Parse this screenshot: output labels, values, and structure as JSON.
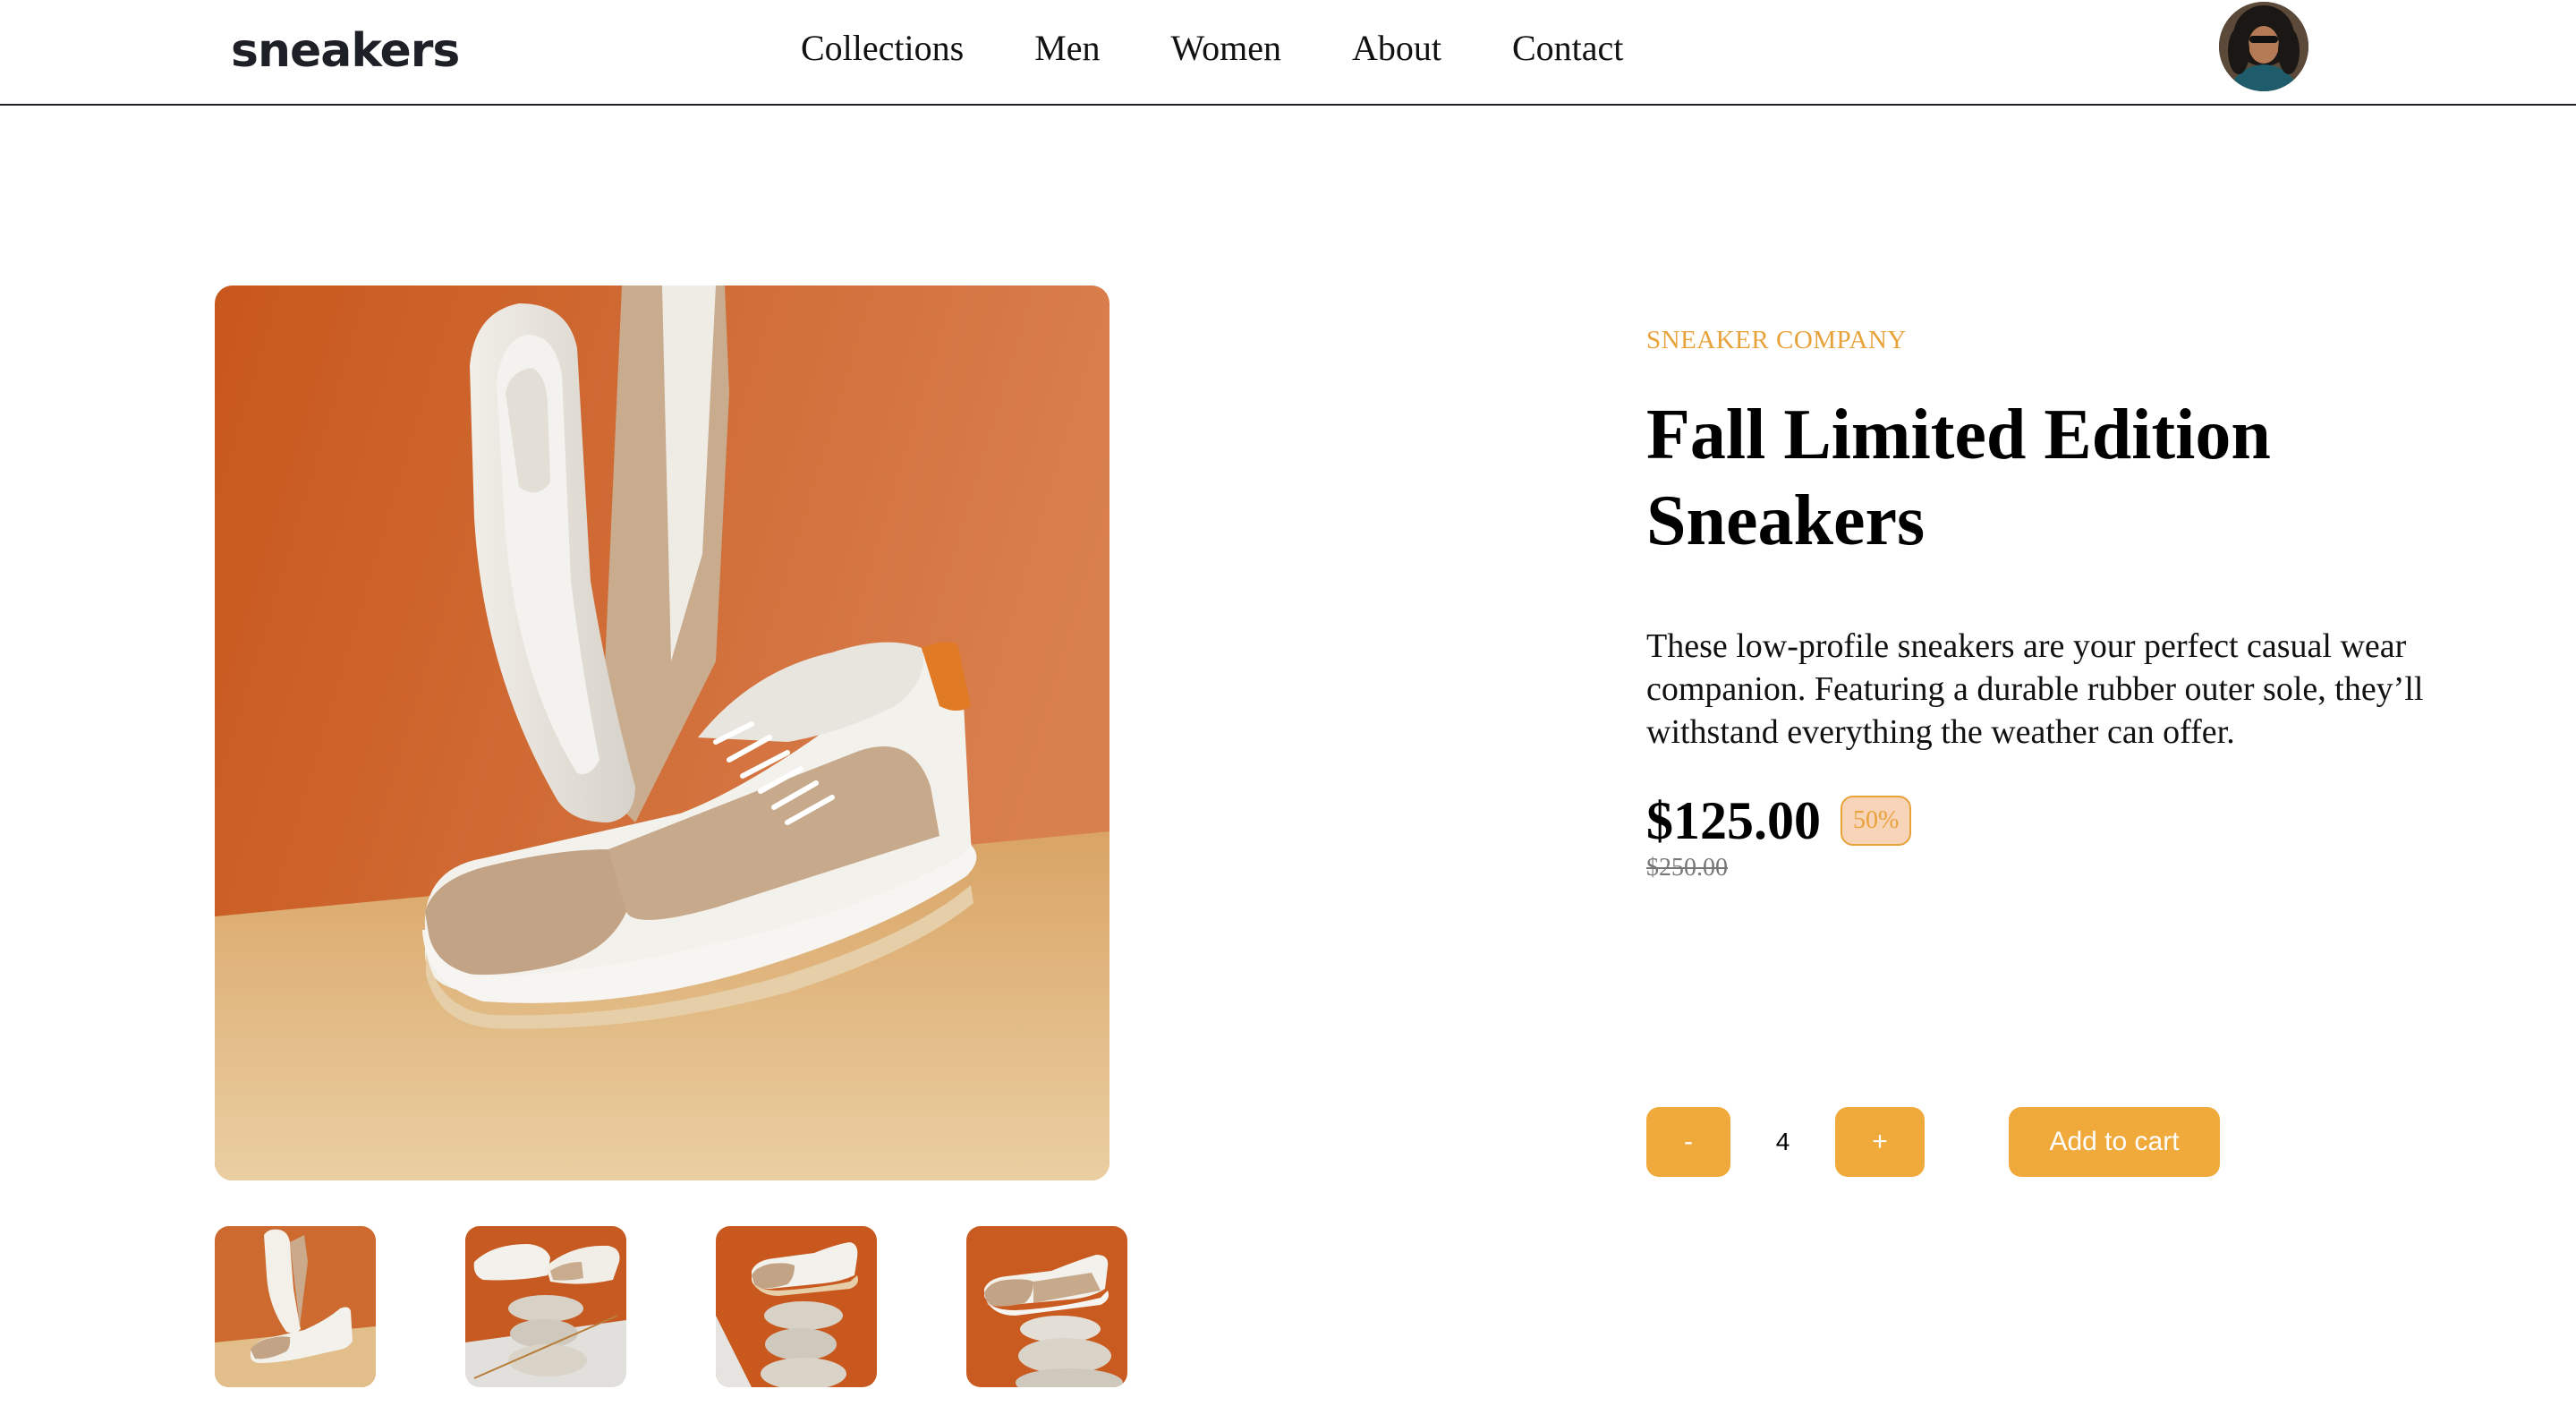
{
  "header": {
    "logo": "sneakers",
    "nav": [
      "Collections",
      "Men",
      "Women",
      "About",
      "Contact"
    ]
  },
  "product": {
    "company": "SNEAKER COMPANY",
    "title": "Fall Limited Edition Sneakers",
    "description": "These low-profile sneakers are your perfect casual wear companion. Featuring a durable rubber outer sole, they’ll withstand everything the weather can offer.",
    "price": "$125.00",
    "discount": "50%",
    "original_price": "$250.00"
  },
  "cart": {
    "minus_label": "-",
    "quantity": "4",
    "plus_label": "+",
    "add_label": "Add to cart"
  },
  "colors": {
    "accent": "#f0a93b",
    "accent_text": "#e8a23a",
    "discount_bg": "#f7d3b8",
    "text_dark": "#1d2026"
  }
}
